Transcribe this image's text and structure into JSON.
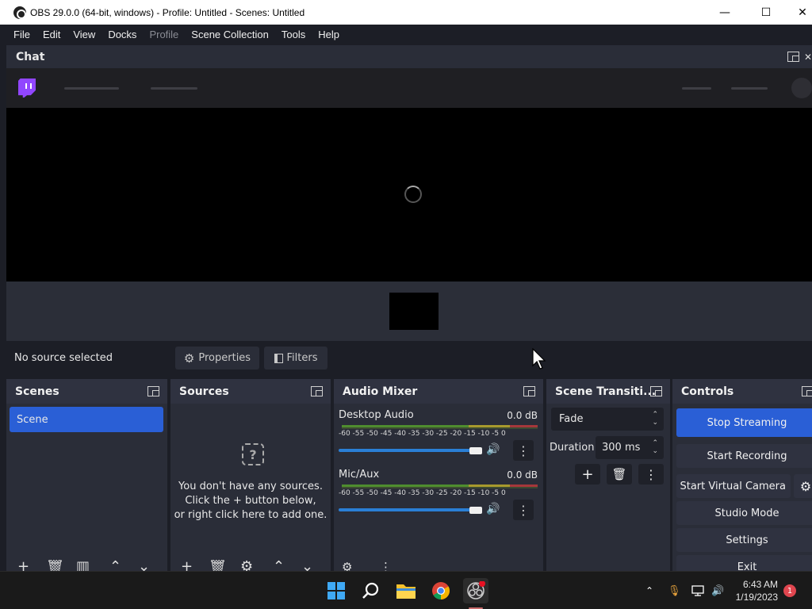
{
  "window": {
    "title": "OBS 29.0.0 (64-bit, windows) - Profile: Untitled - Scenes: Untitled",
    "minimize": "—",
    "maximize": "☐",
    "close": "✕"
  },
  "menu": [
    "File",
    "Edit",
    "View",
    "Docks",
    "Profile",
    "Scene Collection",
    "Tools",
    "Help"
  ],
  "chat": {
    "title": "Chat",
    "close": "✕"
  },
  "source_toolbar": {
    "no_source": "No source selected",
    "properties": "Properties",
    "filters": "Filters"
  },
  "scenes": {
    "title": "Scenes",
    "items": [
      "Scene"
    ]
  },
  "sources": {
    "title": "Sources",
    "empty_line1": "You don't have any sources.",
    "empty_line2": "Click the + button below,",
    "empty_line3": "or right click here to add one."
  },
  "mixer": {
    "title": "Audio Mixer",
    "scale": "-60 -55 -50 -45 -40 -35 -30 -25 -20 -15 -10 -5  0",
    "channels": [
      {
        "name": "Desktop Audio",
        "db": "0.0 dB"
      },
      {
        "name": "Mic/Aux",
        "db": "0.0 dB"
      }
    ]
  },
  "transitions": {
    "title": "Scene Transiti...",
    "selected": "Fade",
    "duration_label": "Duration",
    "duration_value": "300 ms"
  },
  "controls": {
    "title": "Controls",
    "stop_streaming": "Stop Streaming",
    "start_recording": "Start Recording",
    "start_virtual_camera": "Start Virtual Camera",
    "studio_mode": "Studio Mode",
    "settings": "Settings",
    "exit": "Exit"
  },
  "taskbar": {
    "time": "6:43 AM",
    "date": "1/19/2023",
    "notification_count": "1"
  },
  "colors": {
    "accent": "#2a5fd6",
    "twitch": "#9146ff",
    "dock_bg": "#2a2d38",
    "window_bg": "#1c1e26"
  }
}
